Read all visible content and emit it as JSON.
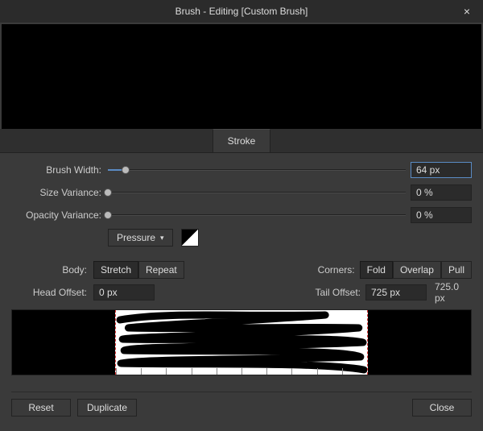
{
  "titlebar": {
    "title": "Brush - Editing [Custom Brush]",
    "close": "×"
  },
  "tabs": {
    "stroke": "Stroke"
  },
  "sliders": {
    "brush_width": {
      "label": "Brush Width:",
      "value": "64 px",
      "percent": 6
    },
    "size_variance": {
      "label": "Size Variance:",
      "value": "0 %",
      "percent": 0
    },
    "opacity_variance": {
      "label": "Opacity Variance:",
      "value": "0 %",
      "percent": 0
    }
  },
  "controller": {
    "label": "Pressure"
  },
  "body": {
    "label": "Body:",
    "options": {
      "stretch": "Stretch",
      "repeat": "Repeat"
    },
    "selected": "stretch"
  },
  "corners": {
    "label": "Corners:",
    "options": {
      "fold": "Fold",
      "overlap": "Overlap",
      "pull": "Pull"
    },
    "selected": "fold"
  },
  "head_offset": {
    "label": "Head Offset:",
    "value": "0 px"
  },
  "tail_offset": {
    "label": "Tail Offset:",
    "value": "725 px",
    "max": "725.0 px"
  },
  "footer": {
    "reset": "Reset",
    "duplicate": "Duplicate",
    "close": "Close"
  }
}
